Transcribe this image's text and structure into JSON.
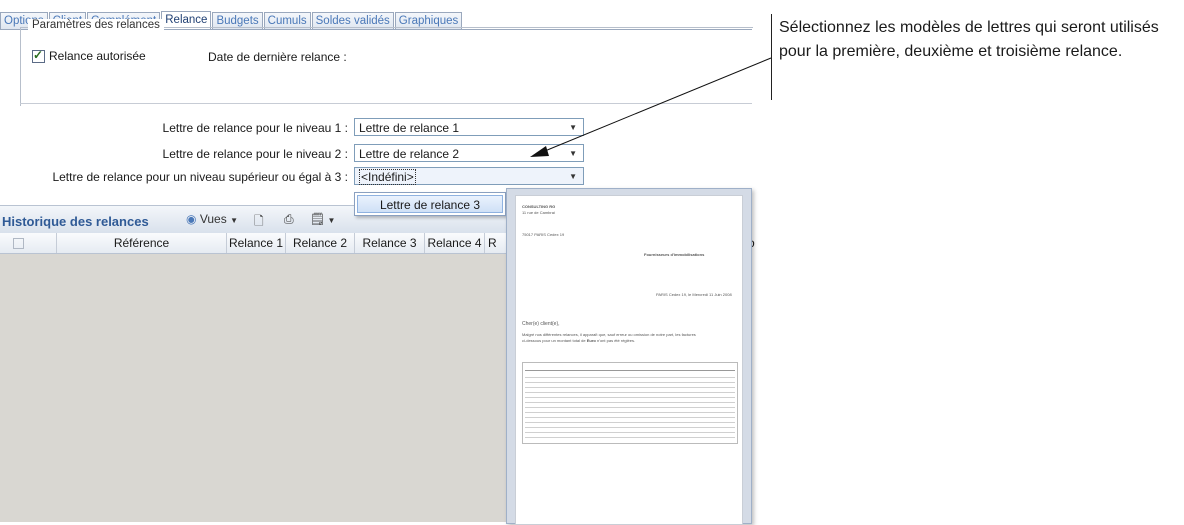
{
  "tabs": [
    "Options",
    "Client",
    "Complément",
    "Relance",
    "Budgets",
    "Cumuls",
    "Soldes validés",
    "Graphiques"
  ],
  "group": {
    "title": "Paramètres des relances",
    "checkbox_label": "Relance autorisée",
    "checked": true,
    "last_date_label": "Date de dernière relance :"
  },
  "letters": {
    "level1_label": "Lettre de relance pour le niveau 1 :",
    "level1_value": "Lettre de relance 1",
    "level2_label": "Lettre de relance pour le niveau 2 :",
    "level2_value": "Lettre de relance 2",
    "level3_label": "Lettre de relance pour un niveau supérieur ou égal à 3 :",
    "level3_value": "<Indéfini>"
  },
  "dropdown": {
    "option": "Lettre de relance 3"
  },
  "history": {
    "title": "Historique des relances",
    "views_label": "Vues",
    "columns": [
      "Référence",
      "Relance 1",
      "Relance 2",
      "Relance 3",
      "Relance 4",
      "R",
      "o"
    ]
  },
  "preview": {
    "company": "CONSULTING RG",
    "address": "11 rue de Cambrai",
    "city": "75017 PARIS Cedex 19",
    "recipient": "Fournisseurs d'immobilisations",
    "date_line": "PARIS Cedex 19, le Mercredi 11 Juin 2008",
    "salutation": "Cher(e) client(e),",
    "body1": "Malgré nos différentes relances, il apparaît que, sauf erreur ou omission de notre part, les factures",
    "body2": "ci-dessous pour un montant total de",
    "currency": "Euro",
    "body3": "n'ont pas été réglées."
  },
  "annotation": {
    "text": "Sélectionnez les modèles de lettres qui seront utilisés pour la première, deuxième et troisième relance."
  }
}
